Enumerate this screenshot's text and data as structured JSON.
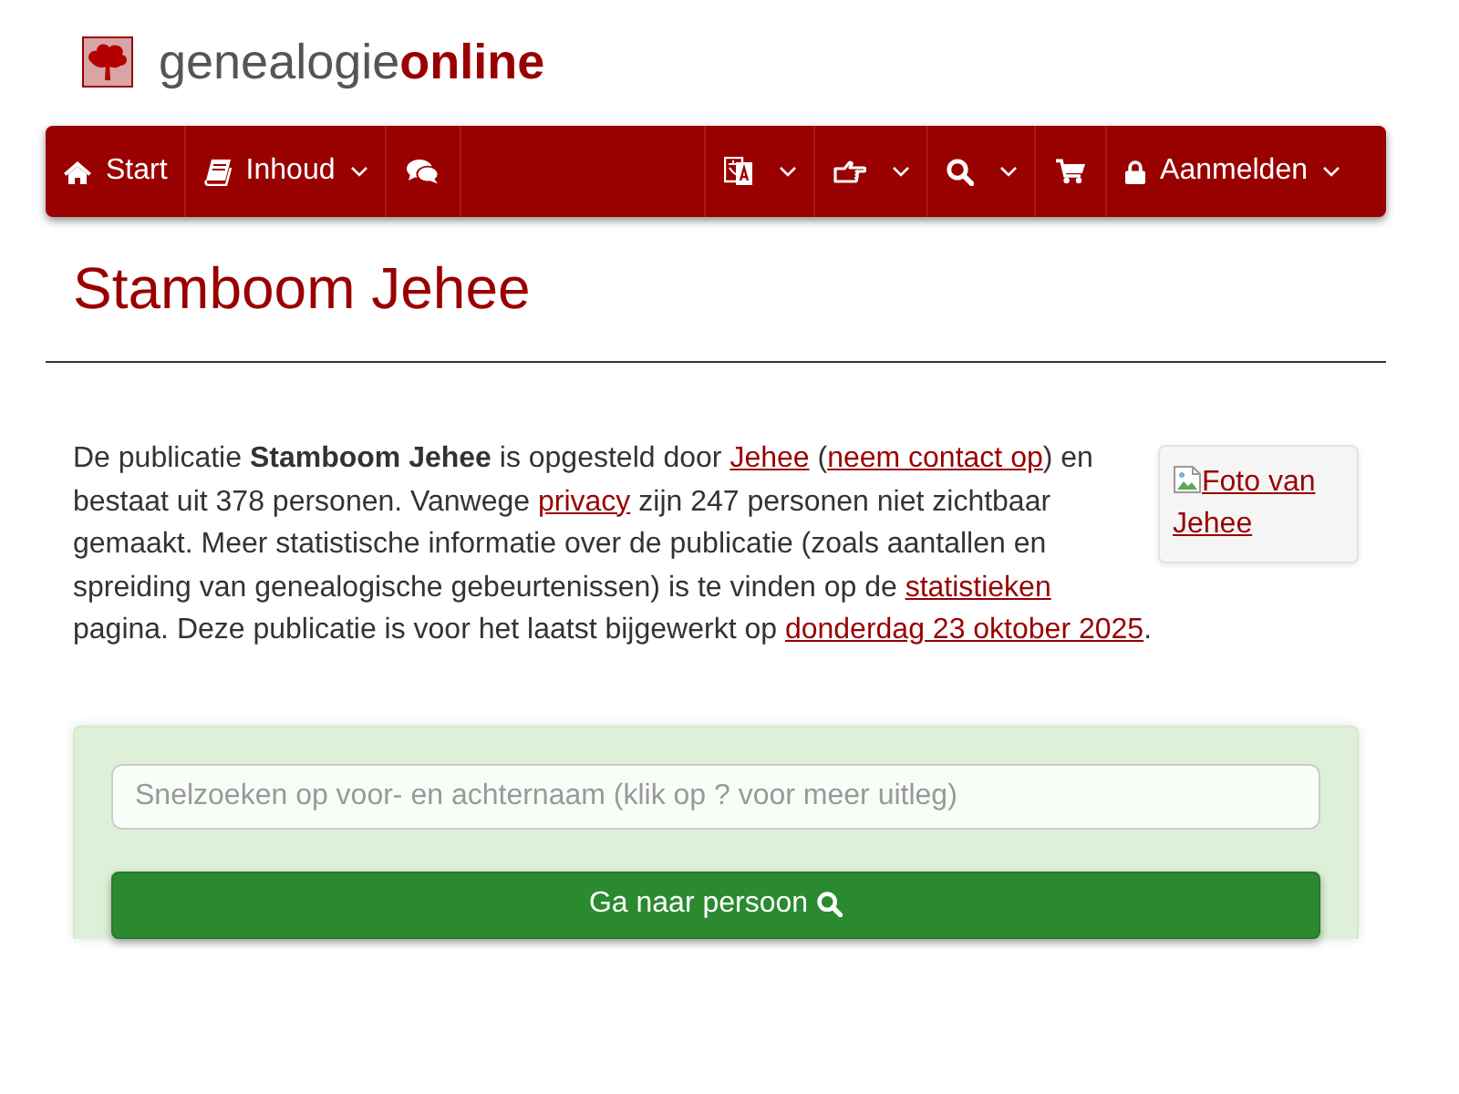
{
  "header": {
    "logo": "genealogie**online**"
  },
  "navbar": {
    "left": [
      {
        "kind": "home",
        "label": "Start",
        "dropdown": false
      },
      {
        "kind": "contents",
        "label": "Inhoud",
        "dropdown": true
      },
      {
        "kind": "forum",
        "dropdown": false
      }
    ],
    "right": [
      {
        "kind": "language",
        "dropdown": true
      },
      {
        "kind": "actions",
        "dropdown": true
      },
      {
        "kind": "search",
        "dropdown": true
      },
      {
        "kind": "shop",
        "dropdown": false
      },
      {
        "kind": "account",
        "label": "Aanmelden",
        "dropdown": true
      }
    ]
  },
  "page_title": "Stamboom Jehee",
  "intro": {
    "parts": [
      {
        "kind": "text",
        "text": "De publicatie **Stamboom Jehee** is opgesteld door "
      },
      {
        "kind": "link",
        "text": "Jehee"
      },
      {
        "kind": "text",
        "text": " ("
      },
      {
        "kind": "link",
        "text": "neem contact op"
      },
      {
        "kind": "text",
        "text": ") en bestaat uit 378 personen. Vanwege "
      },
      {
        "kind": "link",
        "text": "privacy"
      },
      {
        "kind": "text",
        "text": " zijn 247 personen niet zichtbaar gemaakt. Meer statistische informatie over de publicatie (zoals aantallen en spreiding van genealogische gebeurtenissen) is te vinden op de "
      },
      {
        "kind": "link",
        "text": "statistieken"
      },
      {
        "kind": "text",
        "text": " pagina. Deze publicatie is voor het laatst bijgewerkt op "
      },
      {
        "kind": "link",
        "text": "donderdag 23 oktober 2025"
      },
      {
        "kind": "text",
        "text": "."
      }
    ]
  },
  "photo": {
    "alt_text": "Foto van Jehee"
  },
  "quick_search": {
    "placeholder": "Snelzoeken op voor- en achternaam (klik op ? voor meer uitleg)",
    "button": "Ga naar persoon"
  }
}
